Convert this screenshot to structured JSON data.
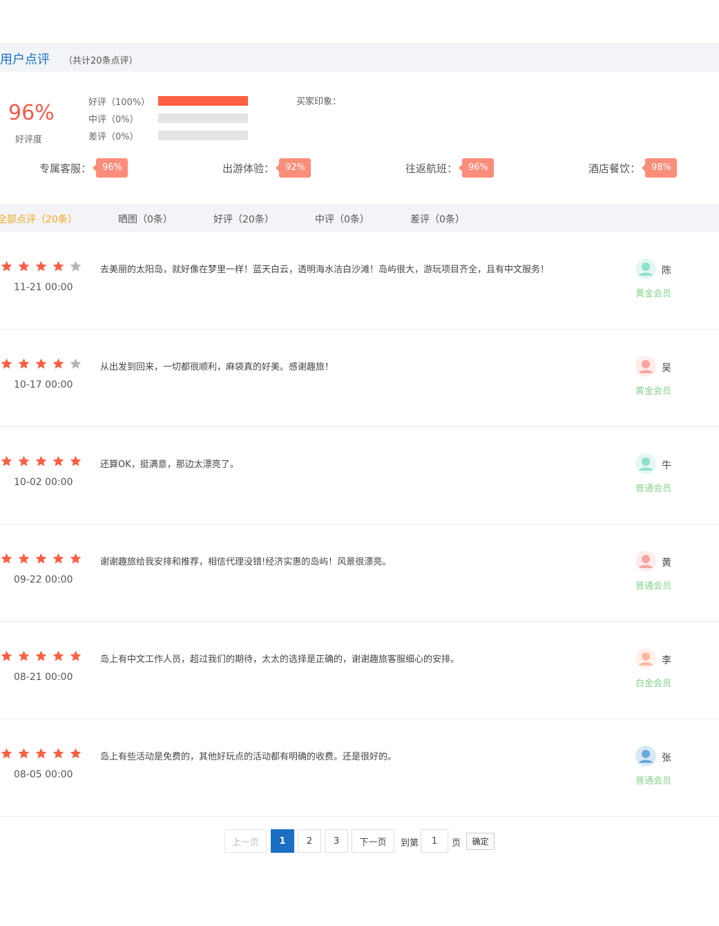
{
  "header": {
    "title": "用户点评",
    "count": "（共计20条点评）"
  },
  "summary": {
    "percent": "96%",
    "percent_label": "好评度",
    "distribution": [
      {
        "label": "好评（100%）",
        "fraction": 1.0
      },
      {
        "label": "中评（0%）",
        "fraction": 0.0
      },
      {
        "label": "差评（0%）",
        "fraction": 0.0
      }
    ],
    "impression_label": "买家印象：",
    "scores": [
      {
        "label": "专属客服：",
        "value": "96%"
      },
      {
        "label": "出游体验：",
        "value": "92%"
      },
      {
        "label": "往返航班：",
        "value": "96%"
      },
      {
        "label": "酒店餐饮：",
        "value": "98%"
      }
    ]
  },
  "colors": {
    "accent": "#1a6fc2",
    "star": "#fc5f42",
    "star_empty": "#b5b5b5",
    "badge": "#fb8d7b",
    "level": "#88d28c",
    "tab_active": "#f5a623"
  },
  "tabs": [
    {
      "label": "全部点评（20条）",
      "active": true
    },
    {
      "label": "晒图（0条）"
    },
    {
      "label": "好评（20条）"
    },
    {
      "label": "中评（0条）"
    },
    {
      "label": "差评（0条）"
    }
  ],
  "reviews": [
    {
      "rating": 4,
      "date": "11-21 00:00",
      "text": "去美丽的太阳岛，就好像在梦里一样！蓝天白云，透明海水洁白沙滩！岛屿很大，游玩项目齐全，且有中文服务！",
      "name": "陈",
      "level": "黄金会员",
      "avatar_icon": "avatar-teal-icon"
    },
    {
      "rating": 4,
      "date": "10-17 00:00",
      "text": "从出发到回来，一切都很顺利，麻袋真的好美。感谢趣旅！",
      "name": "吴",
      "level": "黄金会员",
      "avatar_icon": "avatar-pink-icon"
    },
    {
      "rating": 5,
      "date": "10-02 00:00",
      "text": "还算OK，挺满意，那边太漂亮了。",
      "name": "牛",
      "level": "普通会员",
      "avatar_icon": "avatar-teal-icon"
    },
    {
      "rating": 5,
      "date": "09-22 00:00",
      "text": "谢谢趣旅给我安排和推荐，相信代理没错!经济实惠的岛屿！风景很漂亮。",
      "name": "黄",
      "level": "普通会员",
      "avatar_icon": "avatar-pink-icon"
    },
    {
      "rating": 5,
      "date": "08-21 00:00",
      "text": "岛上有中文工作人员，超过我们的期待，太太的选择是正确的，谢谢趣旅客服细心的安排。",
      "name": "李",
      "level": "白金会员",
      "avatar_icon": "avatar-peach-icon"
    },
    {
      "rating": 5,
      "date": "08-05 00:00",
      "text": "岛上有些活动是免费的，其他好玩点的活动都有明确的收费。还是很好的。",
      "name": "张",
      "level": "普通会员",
      "avatar_icon": "avatar-blue-icon"
    }
  ],
  "pagination": {
    "prev": "上一页",
    "pages": [
      "1",
      "2",
      "3"
    ],
    "current_page": "1",
    "next": "下一页",
    "goto_prefix": "到第",
    "goto_value": "1",
    "goto_suffix": "页",
    "confirm": "确定"
  }
}
